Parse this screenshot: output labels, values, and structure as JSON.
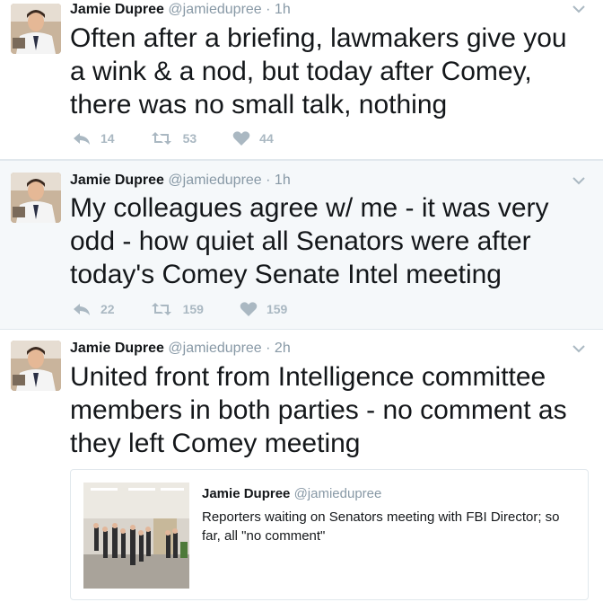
{
  "colors": {
    "text": "#14171a",
    "muted": "#8899a6",
    "action": "#aab8c2",
    "border": "#e1e8ed",
    "highlight_bg": "#f5f8fa"
  },
  "tweets": [
    {
      "name": "Jamie Dupree",
      "handle": "@jamiedupree",
      "separator": "·",
      "time": "1h",
      "text": "Often after a briefing, lawmakers give you a wink & a nod, but today after Comey, there was no small talk, nothing",
      "replies": "14",
      "retweets": "53",
      "likes": "44",
      "icons": {
        "reply": "reply-icon",
        "retweet": "retweet-icon",
        "like": "heart-icon",
        "menu": "chevron-down-icon"
      }
    },
    {
      "name": "Jamie Dupree",
      "handle": "@jamiedupree",
      "separator": "·",
      "time": "1h",
      "text": "My colleagues agree w/ me - it was very odd - how quiet all Senators were after today's Comey Senate Intel meeting",
      "replies": "22",
      "retweets": "159",
      "likes": "159"
    },
    {
      "name": "Jamie Dupree",
      "handle": "@jamiedupree",
      "separator": "·",
      "time": "2h",
      "text": "United front from Intelligence committee members in both parties - no comment as they left Comey meeting",
      "quote": {
        "name": "Jamie Dupree",
        "handle": "@jamiedupree",
        "text": "Reporters waiting on Senators meeting with FBI Director; so far, all \"no comment\""
      }
    }
  ]
}
